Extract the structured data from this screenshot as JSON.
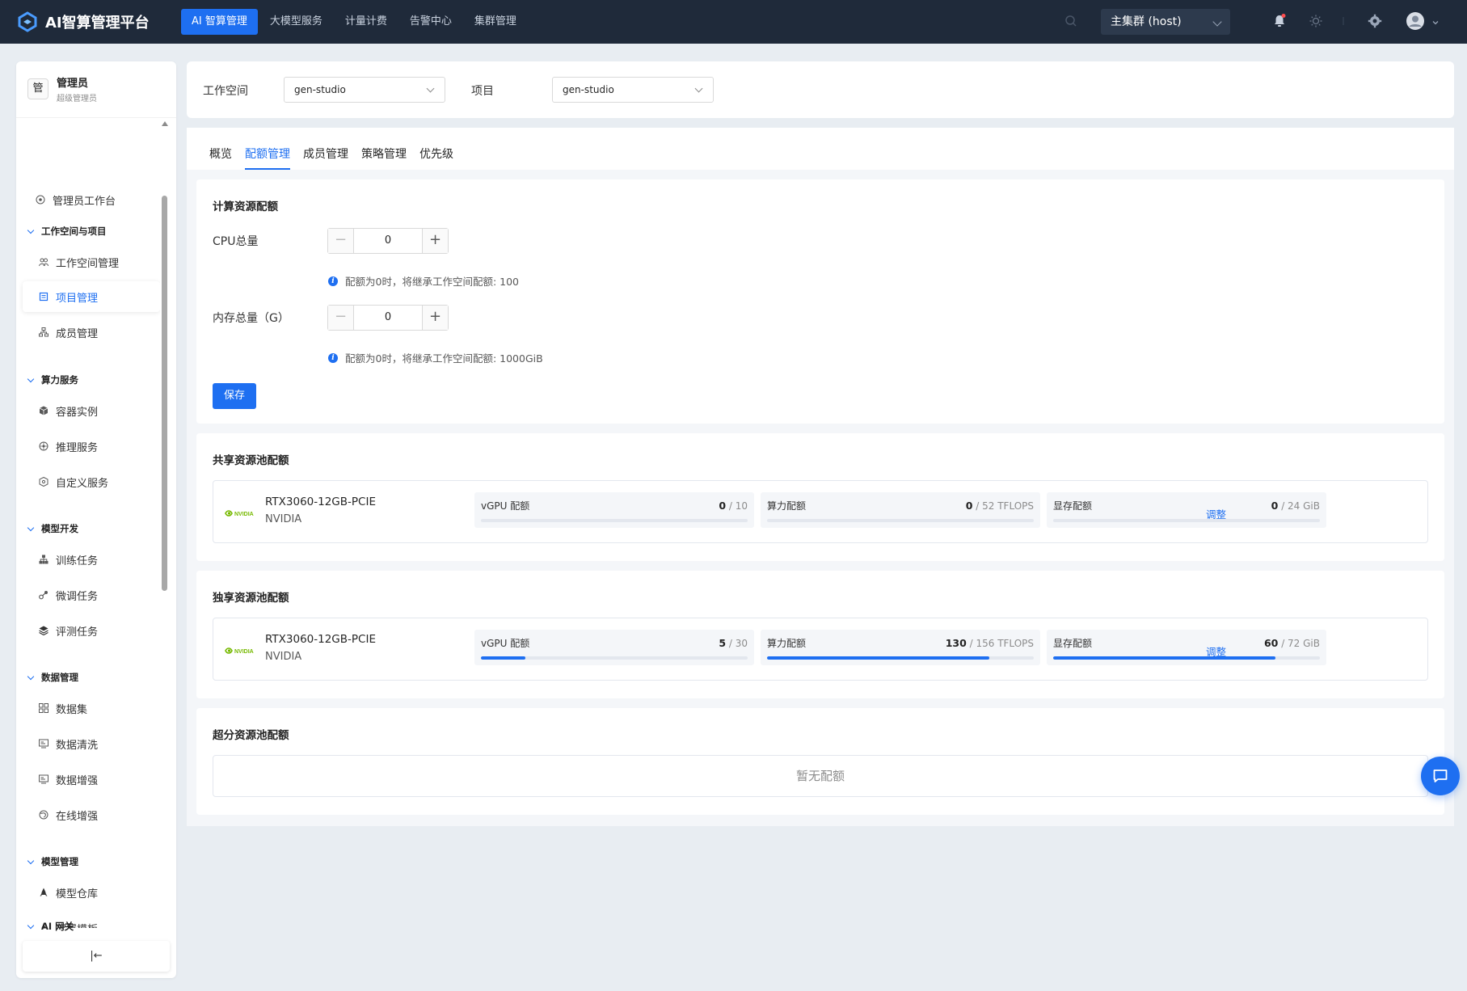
{
  "app": {
    "title": "AI智算管理平台"
  },
  "topnav": [
    {
      "label": "AI 智算管理",
      "active": true
    },
    {
      "label": "大模型服务"
    },
    {
      "label": "计量计费"
    },
    {
      "label": "告警中心"
    },
    {
      "label": "集群管理"
    }
  ],
  "header": {
    "cluster": "主集群 (host)"
  },
  "user": {
    "avatar": "管",
    "name": "管理员",
    "role": "超级管理员"
  },
  "sidebar": {
    "workbench": "管理员工作台",
    "groups": [
      {
        "label": "工作空间与项目",
        "items": [
          "工作空间管理",
          "项目管理",
          "成员管理"
        ]
      },
      {
        "label": "算力服务",
        "items": [
          "容器实例",
          "推理服务",
          "自定义服务"
        ]
      },
      {
        "label": "模型开发",
        "items": [
          "训练任务",
          "微调任务",
          "评测任务"
        ]
      },
      {
        "label": "数据管理",
        "items": [
          "数据集",
          "数据清洗",
          "数据增强",
          "在线增强"
        ]
      },
      {
        "label": "模型管理",
        "items": [
          "模型仓库",
          "部署模板"
        ]
      },
      {
        "label": "AI 网关",
        "items": []
      }
    ],
    "active_item": "项目管理",
    "collapse_icon": "|←"
  },
  "filters": {
    "workspace_label": "工作空间",
    "workspace_value": "gen-studio",
    "project_label": "项目",
    "project_value": "gen-studio"
  },
  "tabs": [
    {
      "label": "概览"
    },
    {
      "label": "配额管理",
      "active": true
    },
    {
      "label": "成员管理"
    },
    {
      "label": "策略管理"
    },
    {
      "label": "优先级"
    }
  ],
  "compute": {
    "title": "计算资源配额",
    "cpu_label": "CPU总量",
    "cpu_value": "0",
    "cpu_hint": "配额为0时，将继承工作空间配额: 100",
    "mem_label": "内存总量（G）",
    "mem_value": "0",
    "mem_hint": "配额为0时，将继承工作空间配额: 1000GiB",
    "save_label": "保存",
    "minus": "−",
    "plus": "+",
    "info": "i"
  },
  "shared_pool": {
    "title": "共享资源池配额",
    "gpu_model": "RTX3060-12GB-PCIE",
    "vendor": "NVIDIA",
    "vgpu": {
      "label": "vGPU 配额",
      "used": "0",
      "total": "/ 10",
      "fraction": 0
    },
    "compute": {
      "label": "算力配额",
      "used": "0",
      "total": "/ 52 TFLOPS",
      "fraction": 0
    },
    "memory": {
      "label": "显存配额",
      "used": "0",
      "total": "/ 24 GiB",
      "fraction": 0
    },
    "adjust": "调整"
  },
  "exclusive_pool": {
    "title": "独享资源池配额",
    "gpu_model": "RTX3060-12GB-PCIE",
    "vendor": "NVIDIA",
    "vgpu": {
      "label": "vGPU 配额",
      "used": "5",
      "total": "/ 30",
      "fraction": 0.1667
    },
    "compute": {
      "label": "算力配额",
      "used": "130",
      "total": "/ 156 TFLOPS",
      "fraction": 0.8333
    },
    "memory": {
      "label": "显存配额",
      "used": "60",
      "total": "/ 72 GiB",
      "fraction": 0.8333
    },
    "adjust": "调整"
  },
  "oversold_pool": {
    "title": "超分资源池配额",
    "empty": "暂无配额"
  },
  "colors": {
    "accent": "#1e6ff1",
    "topbar": "#1f2a3a",
    "nvidia": "#76b900"
  }
}
